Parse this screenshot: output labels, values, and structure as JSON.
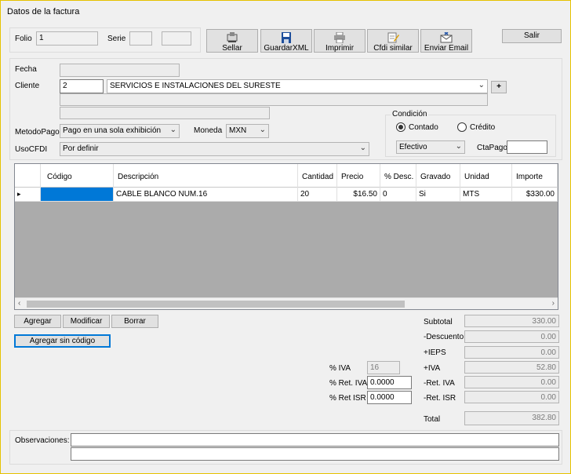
{
  "window": {
    "title": "Datos de la factura"
  },
  "header": {
    "folio_label": "Folio",
    "folio_value": "1",
    "serie_label": "Serie",
    "serie_value": "",
    "serie_value2": ""
  },
  "toolbar": {
    "sellar": "Sellar",
    "guardar_xml": "GuardarXML",
    "imprimir": "Imprimir",
    "cfdi_similar": "Cfdi similar",
    "enviar_email": "Enviar Email",
    "salir": "Salir"
  },
  "form": {
    "fecha_label": "Fecha",
    "fecha_value": "",
    "cliente_label": "Cliente",
    "cliente_id": "2",
    "cliente_name": "SERVICIOS E INSTALACIONES DEL SURESTE",
    "add_cliente": "+",
    "cliente_extra1": "",
    "cliente_extra2": "",
    "metodo_pago_label": "MetodoPago",
    "metodo_pago_value": "Pago en una sola exhibición",
    "moneda_label": "Moneda",
    "moneda_value": "MXN",
    "uso_cfdi_label": "UsoCFDI",
    "uso_cfdi_value": "Por definir"
  },
  "condicion": {
    "title": "Condición",
    "contado": "Contado",
    "credito": "Crédito",
    "selected": "Contado",
    "forma_pago": "Efectivo",
    "cta_pago_label": "CtaPago",
    "cta_pago_value": ""
  },
  "grid": {
    "columns": [
      "Código",
      "Descripción",
      "Cantidad",
      "Precio",
      "% Desc.",
      "Gravado",
      "Unidad",
      "Importe"
    ],
    "rows": [
      [
        "",
        "CABLE BLANCO NUM.16",
        "20",
        "$16.50",
        "0",
        "Si",
        "MTS",
        "$330.00"
      ]
    ],
    "row_pointer": "▸"
  },
  "actions": {
    "agregar": "Agregar",
    "modificar": "Modificar",
    "borrar": "Borrar",
    "agregar_sin_codigo": "Agregar sin código"
  },
  "taxes": {
    "iva_label": "% IVA",
    "iva_value": "16",
    "ret_iva_label": "% Ret. IVA",
    "ret_iva_value": "0.0000",
    "ret_isr_label": "% Ret ISR",
    "ret_isr_value": "0.0000"
  },
  "totals": {
    "subtotal_label": "Subtotal",
    "subtotal": "330.00",
    "descuento_label": "-Descuento",
    "descuento": "0.00",
    "ieps_label": "+IEPS",
    "ieps": "0.00",
    "iva_label": "+IVA",
    "iva": "52.80",
    "ret_iva_label": "-Ret. IVA",
    "ret_iva": "0.00",
    "ret_isr_label": "-Ret. ISR",
    "ret_isr": "0.00",
    "total_label": "Total",
    "total": "382.80"
  },
  "observaciones": {
    "label": "Observaciones:",
    "line1": "",
    "line2": ""
  },
  "colors": {
    "accent": "#0078d7",
    "window_border": "#e6c200",
    "background": "#f0f0f0"
  }
}
